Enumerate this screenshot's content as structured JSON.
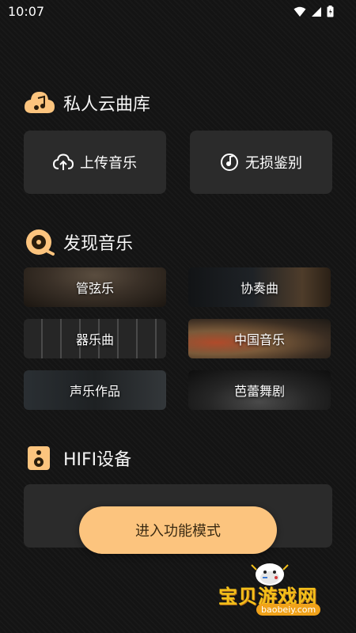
{
  "status_bar": {
    "time": "10:07"
  },
  "cloud_library": {
    "title": "私人云曲库",
    "upload_label": "上传音乐",
    "lossless_label": "无损鉴别"
  },
  "discover": {
    "title": "发现音乐",
    "genres": [
      "管弦乐",
      "协奏曲",
      "器乐曲",
      "中国音乐",
      "声乐作品",
      "芭蕾舞剧"
    ]
  },
  "hifi": {
    "title": "HIFI设备",
    "enter_label": "进入功能模式"
  },
  "watermark": {
    "text": "宝贝游戏网",
    "url": "baobeiy.com"
  },
  "colors": {
    "accent": "#fcc47e",
    "card": "#2b2b2b",
    "background": "#141414"
  }
}
